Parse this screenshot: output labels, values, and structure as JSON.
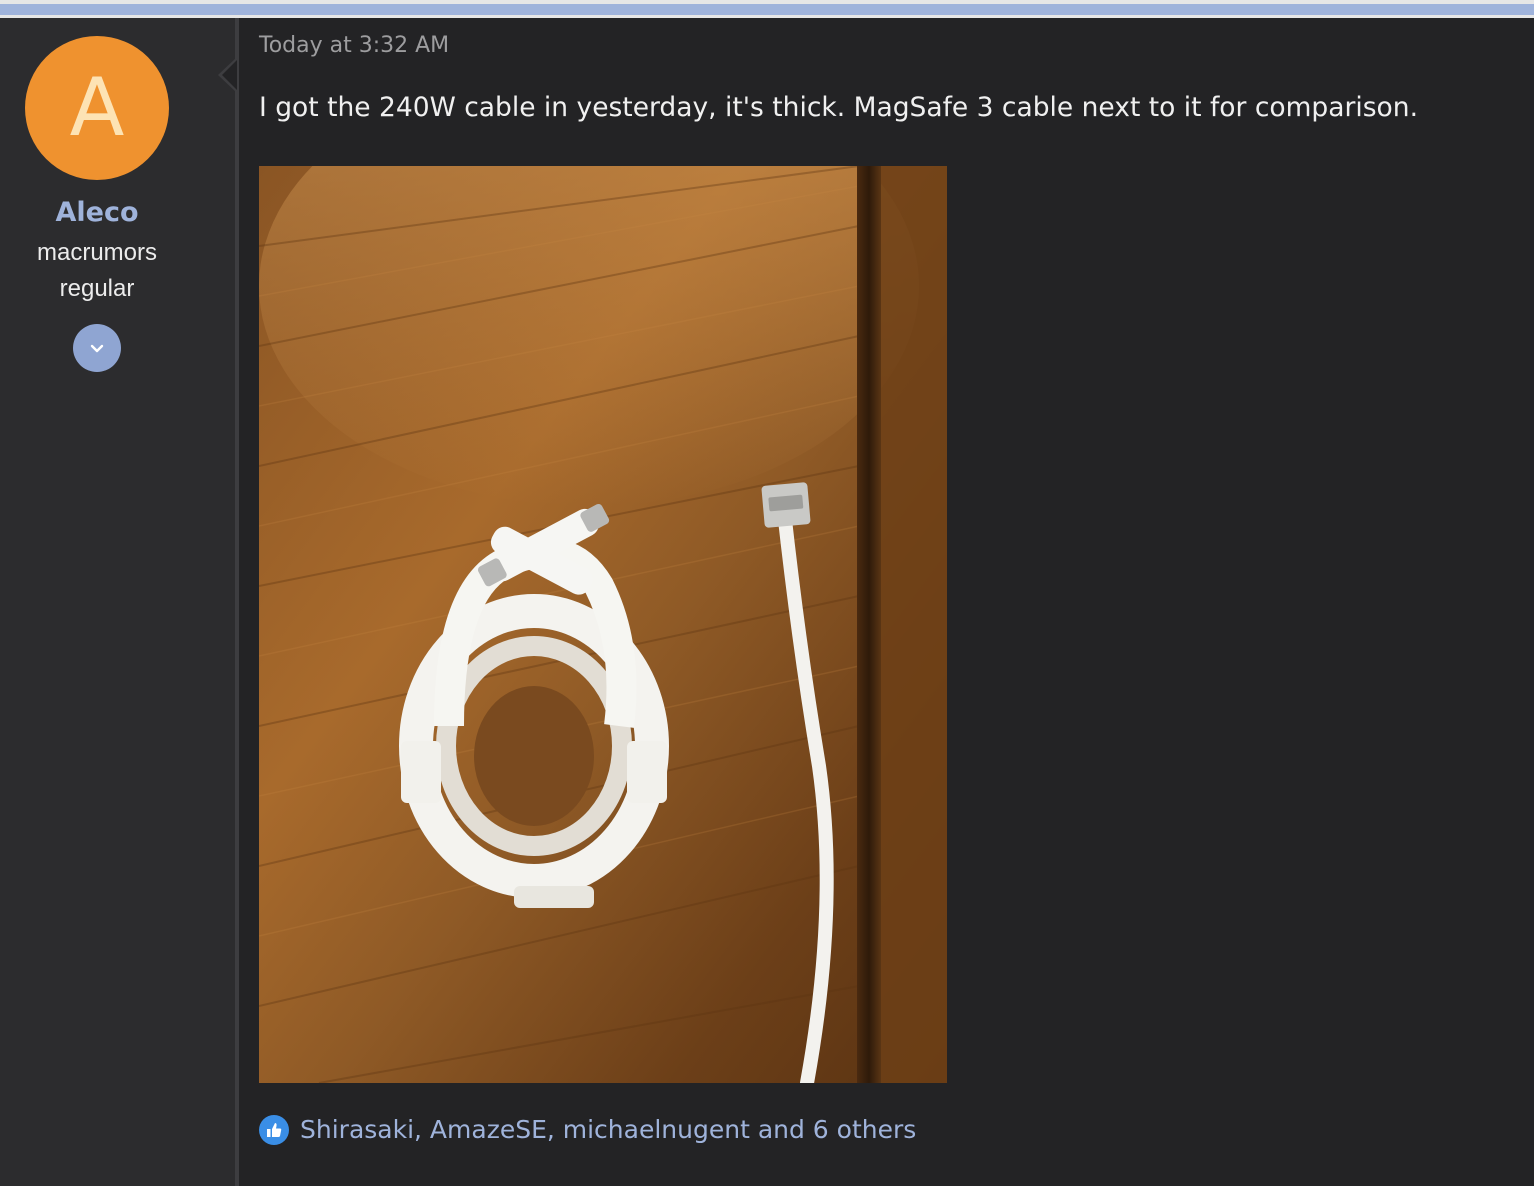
{
  "post": {
    "author": {
      "avatar_letter": "A",
      "avatar_color": "#ef922f",
      "name": "Aleco",
      "title_line1": "macrumors",
      "title_line2": "regular"
    },
    "timestamp": "Today at 3:32 AM",
    "message": "I got the 240W cable in yesterday, it's thick. MagSafe 3 cable next to it for comparison.",
    "reactions": {
      "icon": "thumbs-up-icon",
      "text": "Shirasaki, AmazeSE, michaelnugent and 6 others"
    }
  },
  "colors": {
    "background": "#232325",
    "user_column": "#2c2c2e",
    "link": "#9fb3db",
    "accent_bar": "#9fb3db",
    "like_badge": "#3a8ee6"
  }
}
